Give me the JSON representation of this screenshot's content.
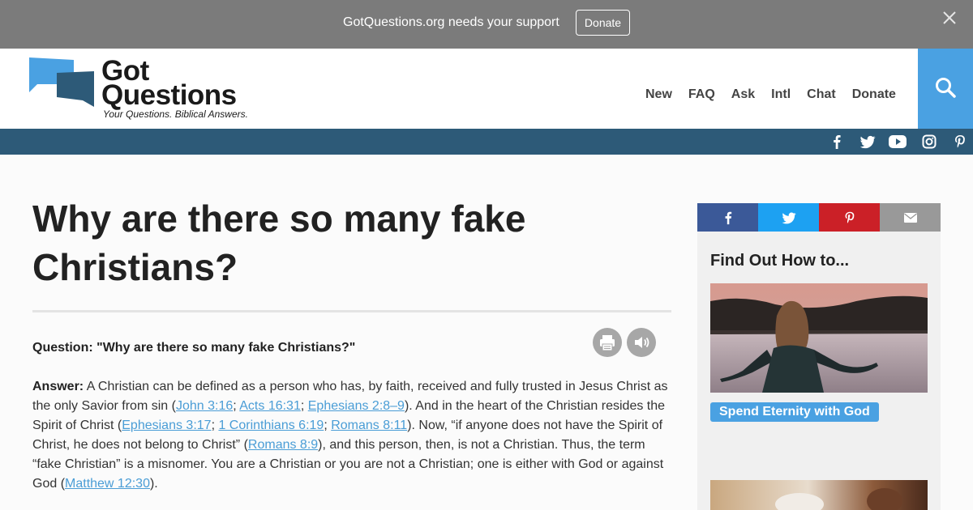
{
  "banner": {
    "text": "GotQuestions.org needs your support",
    "donate_label": "Donate"
  },
  "logo": {
    "line1": "Got",
    "line2": "Questions",
    "tagline": "Your Questions. Biblical Answers."
  },
  "nav": {
    "items": [
      "New",
      "FAQ",
      "Ask",
      "Intl",
      "Chat",
      "Donate"
    ]
  },
  "social_icons": [
    "facebook-icon",
    "twitter-icon",
    "youtube-icon",
    "instagram-icon",
    "pinterest-icon"
  ],
  "colors": {
    "accent_blue": "#4aa1e2",
    "bar_navy": "#2d5a78",
    "banner_gray": "#7b7b7b",
    "facebook": "#3b5998",
    "twitter": "#1da1f2",
    "pinterest": "#cb2027",
    "email": "#999999",
    "link": "#4a9dd6"
  },
  "article": {
    "title": "Why are there so many fake Christians?",
    "question_label": "Question: \"Why are there so many fake Christians?\"",
    "answer_label": "Answer:",
    "answer_parts": [
      " A Christian can be defined as a person who has, by faith, received and fully trusted in Jesus Christ as the only Savior from sin (",
      "John 3:16",
      "; ",
      "Acts 16:31",
      "; ",
      "Ephesians 2:8–9",
      "). And in the heart of the Christian resides the Spirit of Christ (",
      "Ephesians 3:17",
      "; ",
      "1 Corinthians 6:19",
      "; ",
      "Romans 8:11",
      "). Now, “if anyone does not have the Spirit of Christ, he does not belong to Christ” (",
      "Romans 8:9",
      "), and this person, then, is not a Christian. Thus, the term “fake Christian” is a misnomer. You are a Christian or you are not a Christian; one is either with God or against God (",
      "Matthew 12:30",
      ")."
    ]
  },
  "sidebar": {
    "title": "Find Out How to...",
    "promo_button": "Spend Eternity with God"
  }
}
